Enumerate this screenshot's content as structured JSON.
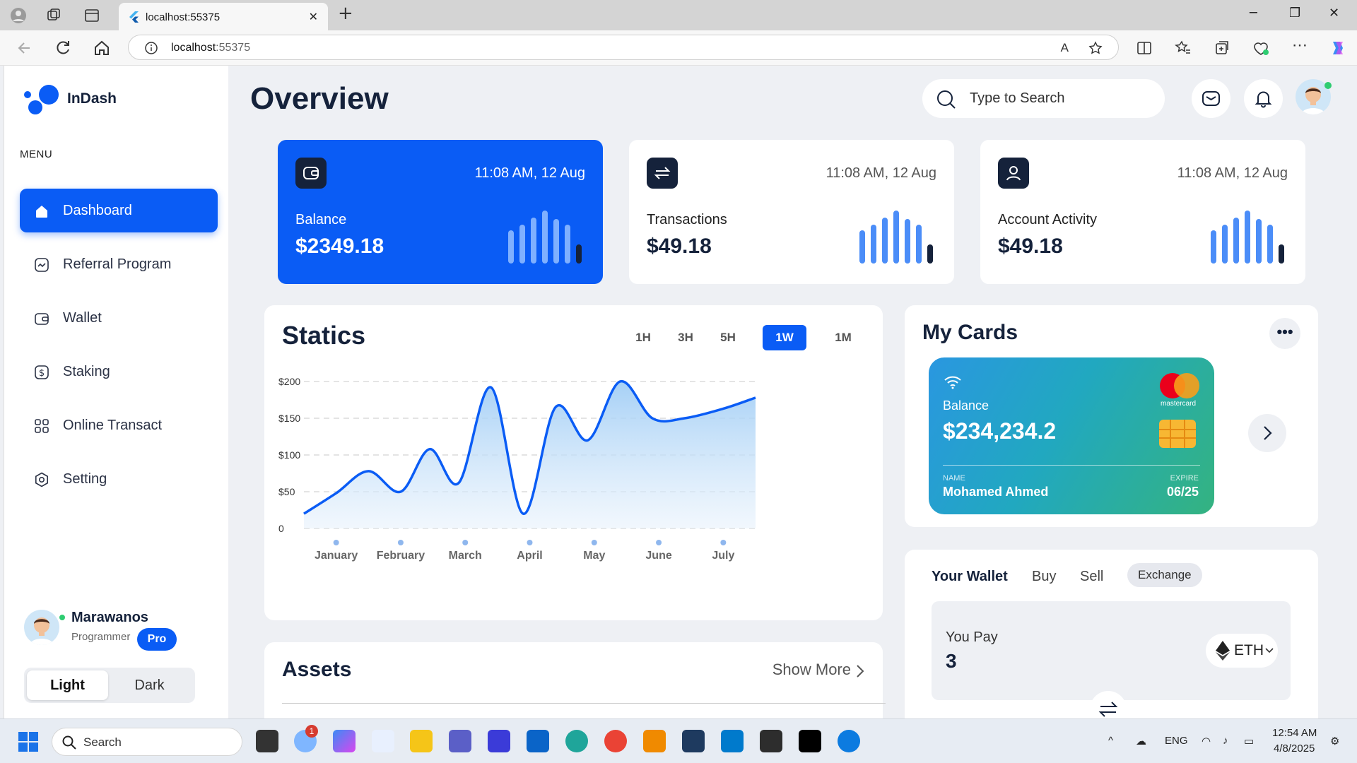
{
  "browser": {
    "tab_title": "localhost:55375",
    "url_host": "localhost",
    "url_port": ":55375"
  },
  "sidebar": {
    "brand": "InDash",
    "menu_title": "MENU",
    "items": [
      {
        "label": "Dashboard",
        "icon": "home-icon",
        "active": true
      },
      {
        "label": "Referral Program",
        "icon": "chart-icon",
        "active": false
      },
      {
        "label": "Wallet",
        "icon": "wallet-icon",
        "active": false
      },
      {
        "label": "Staking",
        "icon": "dollar-icon",
        "active": false
      },
      {
        "label": "Online Transact",
        "icon": "grid-icon",
        "active": false
      },
      {
        "label": "Setting",
        "icon": "gear-icon",
        "active": false
      }
    ],
    "profile": {
      "name": "Marawanos",
      "role": "Programmer",
      "badge": "Pro"
    },
    "theme": {
      "light": "Light",
      "dark": "Dark",
      "selected": "Light"
    }
  },
  "header": {
    "title": "Overview",
    "search_placeholder": "Type to Search"
  },
  "stats": [
    {
      "label": "Balance",
      "value": "$2349.18",
      "time": "11:08 AM, 12 Aug",
      "icon": "wallet-icon"
    },
    {
      "label": "Transactions",
      "value": "$49.18",
      "time": "11:08 AM, 12 Aug",
      "icon": "swap-icon"
    },
    {
      "label": "Account Activity",
      "value": "$49.18",
      "time": "11:08 AM, 12 Aug",
      "icon": "user-icon"
    }
  ],
  "statics": {
    "title": "Statics",
    "ranges": [
      "1H",
      "3H",
      "5H",
      "1W",
      "1M"
    ],
    "selected_range": "1W"
  },
  "chart_data": {
    "type": "area",
    "title": "Statics",
    "categories": [
      "January",
      "February",
      "March",
      "April",
      "May",
      "June",
      "July"
    ],
    "y_ticks": [
      "$200",
      "$150",
      "$100",
      "$50",
      "0"
    ],
    "ylim": [
      0,
      200
    ],
    "grid": true,
    "x": [
      0.5,
      1,
      1.5,
      2,
      2.45,
      2.9,
      3.4,
      3.9,
      4.4,
      4.9,
      5.4,
      5.9,
      6.4,
      7.0,
      7.5
    ],
    "values": [
      20,
      48,
      78,
      50,
      108,
      62,
      192,
      20,
      165,
      120,
      200,
      150,
      150,
      163,
      178
    ],
    "series_color": "#0a5cf5"
  },
  "my_cards": {
    "title": "My Cards",
    "card": {
      "balance_label": "Balance",
      "balance": "$234,234.2",
      "name_label": "NAME",
      "name": "Mohamed Ahmed",
      "expire_label": "EXPIRE",
      "expire": "06/25",
      "network": "mastercard"
    }
  },
  "wallet": {
    "tabs": [
      "Your Wallet",
      "Buy",
      "Sell",
      "Exchange"
    ],
    "pay_label": "You Pay",
    "pay_value": "3",
    "currency": "ETH"
  },
  "assets": {
    "title": "Assets",
    "show_more": "Show More"
  },
  "taskbar": {
    "search": "Search",
    "notification_count": "1",
    "lang": "ENG",
    "time": "12:54 AM",
    "date": "4/8/2025"
  },
  "colors": {
    "accent": "#0a5cf5",
    "navy": "#15223b",
    "bg": "#eef0f4"
  }
}
